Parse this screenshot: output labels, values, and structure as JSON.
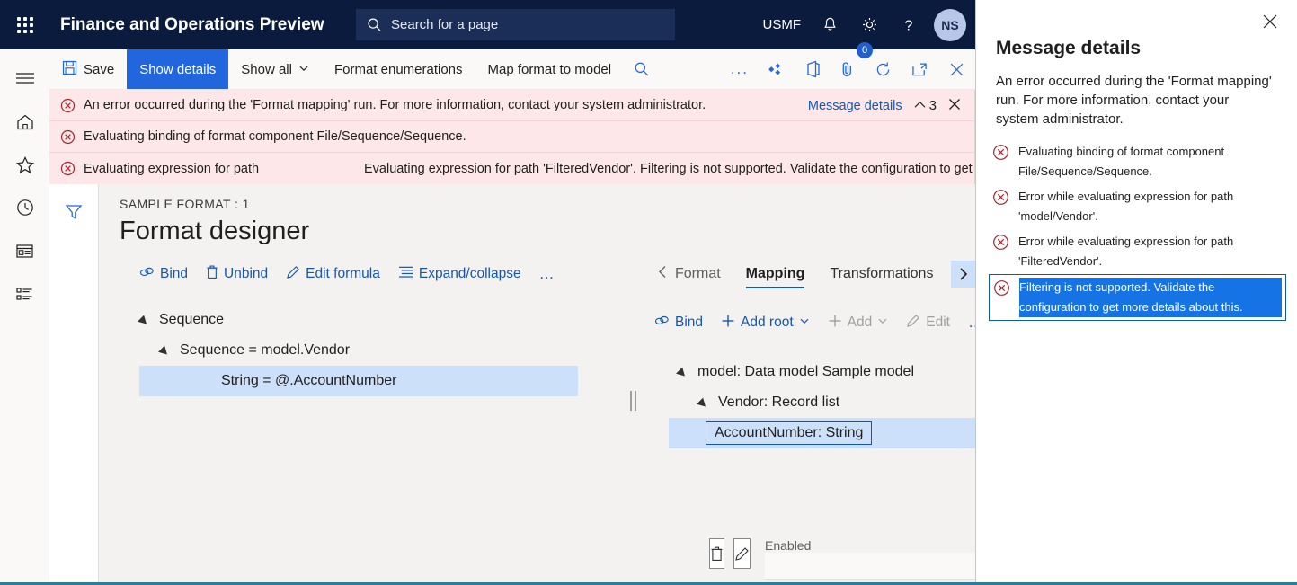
{
  "topbar": {
    "waffle_icon": "app-launcher-icon",
    "app_title": "Finance and Operations Preview",
    "search_placeholder": "Search for a page",
    "search_icon": "search-icon",
    "company": "USMF",
    "notifications_icon": "bell-icon",
    "settings_icon": "gear-icon",
    "help_icon": "question-icon",
    "avatar_initials": "NS"
  },
  "rail": {
    "items": [
      {
        "name": "menu-icon",
        "label": "Menu"
      },
      {
        "name": "home-icon",
        "label": "Home"
      },
      {
        "name": "star-icon",
        "label": "Favorites"
      },
      {
        "name": "clock-icon",
        "label": "Recent"
      },
      {
        "name": "workspace-icon",
        "label": "Workspaces"
      },
      {
        "name": "modules-icon",
        "label": "Modules"
      }
    ]
  },
  "commandbar": {
    "save_label": "Save",
    "save_icon": "save-icon",
    "show_details_label": "Show details",
    "show_all_label": "Show all",
    "show_all_chevron": "chevron-down-icon",
    "format_enumerations_label": "Format enumerations",
    "map_format_to_model_label": "Map format to model",
    "search_icon": "search-icon",
    "overflow_label": "...",
    "share_icon": "share-diamond-icon",
    "office_icon": "office-icon",
    "attachments_icon": "attachment-icon",
    "attachments_count": "0",
    "refresh_icon": "refresh-icon",
    "popout_icon": "open-in-new-window-icon",
    "close_icon": "close-icon"
  },
  "errorbar": {
    "error_icon": "error-circle-icon",
    "rows": [
      {
        "text": "An error occurred during the 'Format mapping' run. For more information, contact your system administrator.",
        "text2": ""
      },
      {
        "text": "Evaluating binding of format component File/Sequence/Sequence.",
        "text2": ""
      },
      {
        "text": "Evaluating expression for path",
        "text2": "Evaluating expression for path 'FilteredVendor'. Filtering is not supported. Validate the configuration to get more"
      }
    ],
    "message_details_link": "Message details",
    "collapse_icon": "chevron-up-icon",
    "count": "3",
    "close_icon": "close-icon"
  },
  "workarea": {
    "filter_icon": "filter-icon",
    "breadcrumb": "SAMPLE FORMAT : 1",
    "page_title": "Format designer"
  },
  "format_pane": {
    "toolbar": [
      {
        "label": "Bind",
        "icon": "bind-link-icon",
        "disabled": false
      },
      {
        "label": "Unbind",
        "icon": "unbind-trash-icon",
        "disabled": false
      },
      {
        "label": "Edit formula",
        "icon": "pencil-icon",
        "disabled": false
      },
      {
        "label": "Expand/collapse",
        "icon": "list-icon",
        "disabled": false
      },
      {
        "label": "…",
        "icon": "overflow-dots-icon",
        "disabled": false
      }
    ],
    "tree": [
      {
        "label": "Sequence",
        "indent": 0,
        "has_caret": true,
        "selected": false
      },
      {
        "label": "Sequence = model.Vendor",
        "indent": 1,
        "has_caret": true,
        "selected": false
      },
      {
        "label": "String = @.AccountNumber",
        "indent": 2,
        "has_caret": false,
        "selected": true
      }
    ]
  },
  "mapping_pane": {
    "tabs": [
      {
        "label": "Format",
        "active": false,
        "back": true
      },
      {
        "label": "Mapping",
        "active": true,
        "back": false
      },
      {
        "label": "Transformations",
        "active": false,
        "back": false
      }
    ],
    "next_icon": "chevron-right-icon",
    "toolbar": [
      {
        "label": "Bind",
        "icon": "bind-link-icon",
        "disabled": false,
        "chevron": false
      },
      {
        "label": "Add root",
        "icon": "plus-icon",
        "disabled": false,
        "chevron": true
      },
      {
        "label": "Add",
        "icon": "plus-icon",
        "disabled": true,
        "chevron": true
      },
      {
        "label": "Edit",
        "icon": "pencil-icon",
        "disabled": true,
        "chevron": false
      },
      {
        "label": "…",
        "icon": "overflow-dots-icon",
        "disabled": false,
        "chevron": false
      }
    ],
    "tree": [
      {
        "label": "model: Data model Sample model",
        "indent": 0,
        "has_caret": true,
        "selected": false,
        "boxed": false
      },
      {
        "label": "Vendor: Record list",
        "indent": 1,
        "has_caret": true,
        "selected": false,
        "boxed": false
      },
      {
        "label": "AccountNumber: String",
        "indent": 2,
        "has_caret": false,
        "selected": true,
        "boxed": true
      }
    ]
  },
  "bottom": {
    "delete_icon": "trash-icon",
    "edit_icon": "pencil-icon",
    "enabled_label": "Enabled",
    "enabled_value": ""
  },
  "sidepanel": {
    "close_icon": "close-icon",
    "title": "Message details",
    "intro": "An error occurred during the 'Format mapping' run. For more information, contact your system administrator.",
    "error_icon": "error-circle-icon",
    "items": [
      {
        "text": "Evaluating binding of format component File/Sequence/Sequence.",
        "selected": false,
        "highlighted": false
      },
      {
        "text": "Error while evaluating expression for path 'model/Vendor'.",
        "selected": false,
        "highlighted": false
      },
      {
        "text": "Error while evaluating expression for path 'FilteredVendor'.",
        "selected": false,
        "highlighted": false
      },
      {
        "text": "Filtering is not supported. Validate the configuration to get more details about this.",
        "selected": true,
        "highlighted": true
      }
    ]
  },
  "colors": {
    "navbar": "#0B1B3D",
    "accent_blue": "#2266DD",
    "link_blue": "#1557B0",
    "error_bg": "#FDE7E9",
    "error_red": "#A4262C",
    "selection_blue": "#CCE0F9",
    "highlight_blue": "#1673E6",
    "bottom_border": "#2E7C9B"
  }
}
